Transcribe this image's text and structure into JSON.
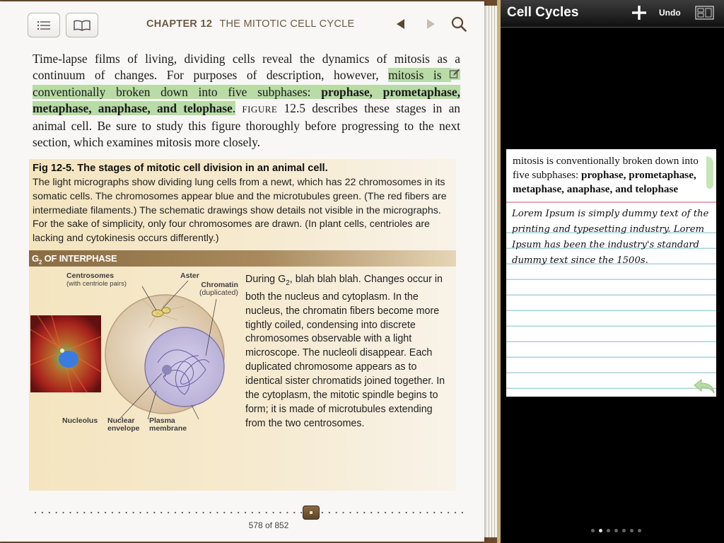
{
  "book": {
    "chapter_number": "CHAPTER 12",
    "chapter_title": "THE MITOTIC CELL CYCLE",
    "page_indicator": "578 of 852",
    "progress_fraction": 0.678
  },
  "body": {
    "t1": "Time-lapse films of living, dividing cells reveal the dynamics of mitosis as a continuum of changes. For purposes of description, however, ",
    "hl1": "mitosis is ",
    "hl2": "conventionally broken down into five subphases: ",
    "hl_bold": "prophase, prometaphase, metaphase, anaphase, and telophase",
    "hl_end": ".",
    "fig_ref": "FIGURE",
    "fig_ref_num": "12.5",
    "t2": " describes these stages in an animal cell. Be sure to study this figure thoroughly before progressing to the next section, which examines mitosis more closely."
  },
  "figure": {
    "title": "Fig 12-5. The stages of mitotic cell division in an animal cell.",
    "caption": "The light micrographs show dividing lung cells from a newt, which has 22 chromosomes in its somatic cells. The chromosomes appear blue and the microtubules green. (The red fibers are intermediate filaments.) The schematic drawings show details not visible in the micrographs. For the sake of simplicity, only four chromosomes are drawn. (In plant cells, centrioles are lacking and cytokinesis occurs differently.)",
    "stage_prefix": "G",
    "stage_sub": "2",
    "stage_suffix": " OF INTERPHASE",
    "labels": {
      "centrosomes": "Centrosomes",
      "centrosomes_sub": "(with centriole pairs)",
      "aster": "Aster",
      "chromatin": "Chromatin",
      "chromatin_sub": "(duplicated)",
      "nucleolus": "Nucleolus",
      "nuclear": "Nuclear",
      "envelope": "envelope",
      "plasma": "Plasma",
      "membrane": "membrane"
    },
    "desc_pre": "During G",
    "desc_sub": "2",
    "desc_post": ", blah blah blah. Changes occur in both the nucleus and cytoplasm. In the nucleus, the chromatin fibers become more tightly coiled, condensing into discrete chromosomes observable with a light microscope. The nucleoli disappear. Each duplicated chromosome appears as to identical sister chromatids joined together. In the cytoplasm, the mitotic spindle begins to form; it is made of microtubules extending from the two centrosomes."
  },
  "notes": {
    "title": "Cell Cycles",
    "undo_label": "Undo",
    "quote_pre": "mitosis is conventionally broken down into five subphases: ",
    "quote_bold": "prophase, prometaphase, metaphase, anaphase, and telophase",
    "handwritten": "Lorem Ipsum is simply dummy text of the printing and typesetting industry. Lorem Ipsum has been the industry's standard dummy text since the 1500s.",
    "page_count": 7,
    "current_page": 2
  },
  "colors": {
    "highlight": "#b9dba6",
    "chapter_text": "#6e5a44",
    "figure_band": "#8a6c43",
    "note_rule": "#a6d3dd",
    "note_separator": "#e2a9b2",
    "bookmark": "#bfe3b0"
  },
  "icons": [
    "toc-list-icon",
    "book-open-icon",
    "prev-page-icon",
    "next-page-icon",
    "search-icon",
    "note-edit-icon",
    "add-note-icon",
    "view-toggle-icon",
    "bookmark-icon",
    "undo-arrow-icon"
  ]
}
